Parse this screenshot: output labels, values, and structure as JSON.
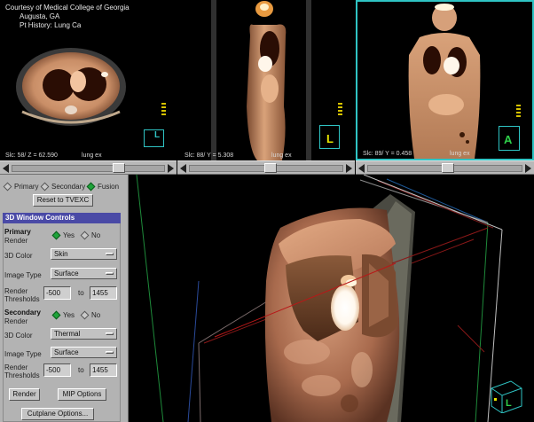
{
  "viewports": {
    "axial": {
      "credit_line1": "Courtesy of Medical College of Georgia",
      "credit_line2": "Augusta, GA",
      "credit_line3": "Pt History: Lung Ca",
      "slice_info": "Slc: 58/   Z = 62.590",
      "slice_extra": "lung ex",
      "orientation_letter": "L"
    },
    "sagittal": {
      "slice_info": "Slc: 88/    Y = 5.308",
      "slice_extra": "lung ex",
      "orientation_letter": "L"
    },
    "coronal": {
      "slice_info": "Slc: 89/    Y = 0.458",
      "slice_extra": "lung ex",
      "orientation_letter": "A"
    }
  },
  "sliders": {
    "axial_position": 0.72,
    "sagittal_position": 0.53,
    "coronal_position": 0.52
  },
  "panel": {
    "mode_options": [
      "Primary",
      "Secondary",
      "Fusion"
    ],
    "mode_selected": "Fusion",
    "reset_button": "Reset to TVEXC",
    "section_title": "3D Window Controls",
    "primary": {
      "label_line1": "Primary",
      "label_line2": "Render",
      "yes": "Yes",
      "no": "No",
      "selected": "Yes",
      "color_label": "3D Color",
      "color_value": "Skin",
      "image_type_label": "Image Type",
      "image_type_value": "Surface",
      "threshold_label_line1": "Render",
      "threshold_label_line2": "Thresholds",
      "threshold_min": "-500",
      "threshold_to": "to",
      "threshold_max": "1455"
    },
    "secondary": {
      "label_line1": "Secondary",
      "label_line2": "Render",
      "yes": "Yes",
      "no": "No",
      "selected": "Yes",
      "color_label": "3D Color",
      "color_value": "Thermal",
      "image_type_label": "Image Type",
      "image_type_value": "Surface",
      "threshold_label_line1": "Render",
      "threshold_label_line2": "Thresholds",
      "threshold_min": "-500",
      "threshold_to": "to",
      "threshold_max": "1455"
    },
    "render_button": "Render",
    "mip_button": "MIP Options",
    "cutplane_button": "Cutplane Options..."
  },
  "render3d": {
    "orientation_letter": "L"
  },
  "colors": {
    "accent_cyan": "#2fc4c4",
    "panel_header": "#4a4aa6",
    "radio_on": "#1ea43a",
    "scale_yellow": "#d6c200"
  }
}
